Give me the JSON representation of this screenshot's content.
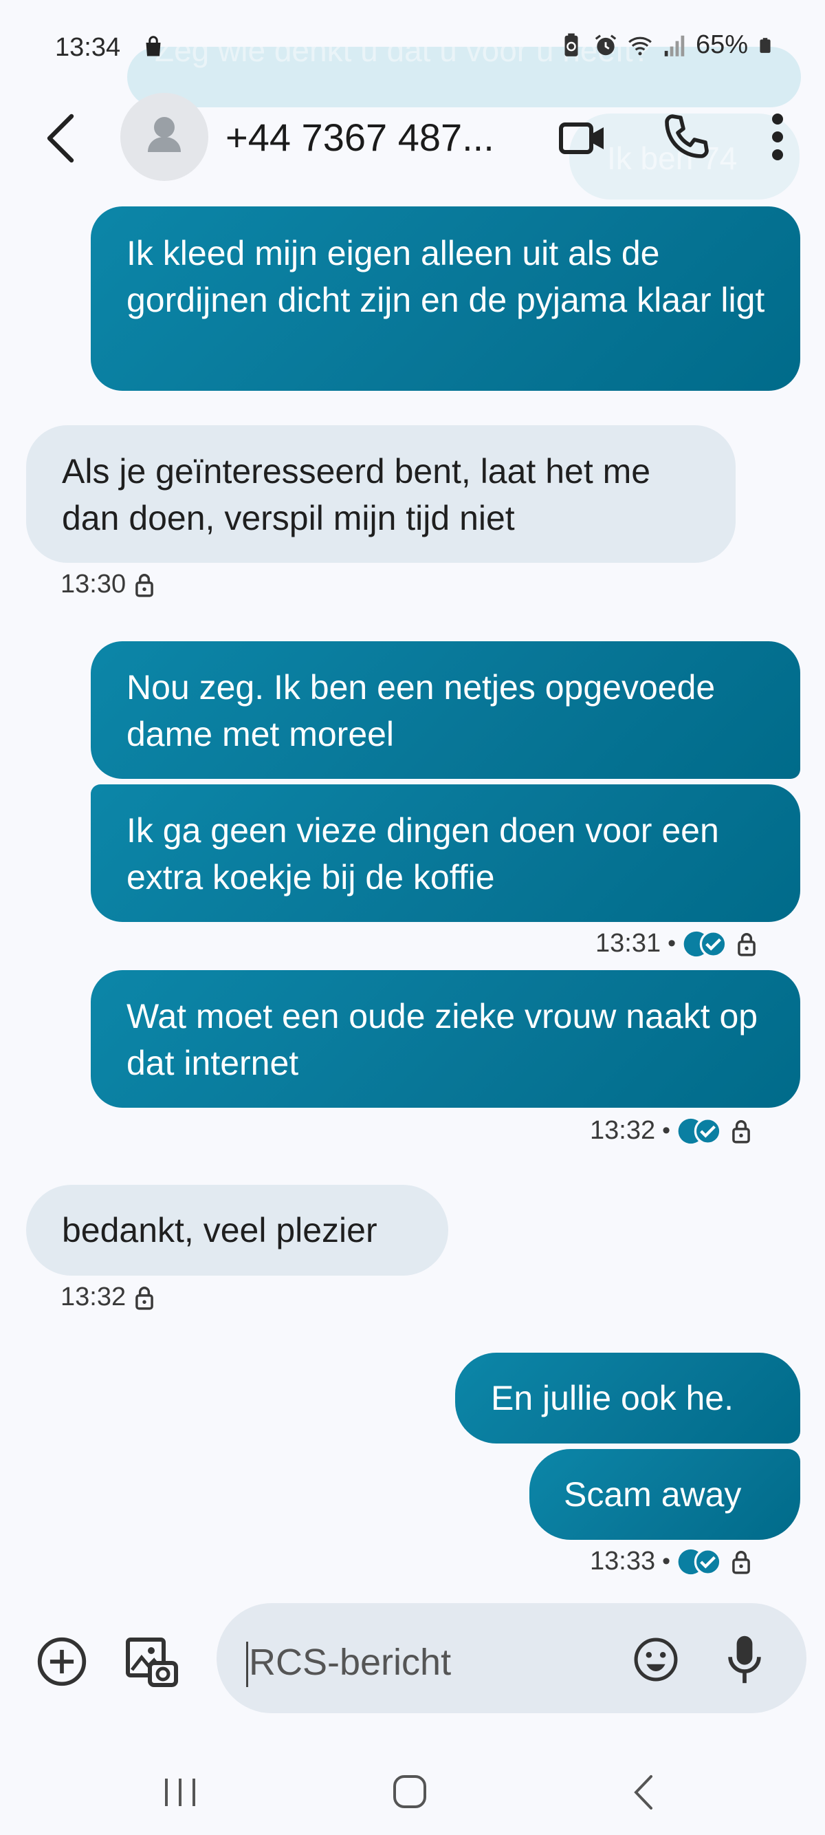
{
  "status_bar": {
    "time": "13:34",
    "battery": "65%",
    "icons": [
      "shopping-bag-icon",
      "battery-saver-icon",
      "alarm-icon",
      "wifi-icon",
      "signal-icon",
      "battery-icon"
    ]
  },
  "ghost_messages": {
    "line1": "Zeg wie denkt u dat u voor u heeft?",
    "line2": "Ik ben 74"
  },
  "header": {
    "contact": "+44 7367 487...",
    "icons": [
      "back-arrow-icon",
      "avatar-icon",
      "video-call-icon",
      "phone-icon",
      "more-vert-icon"
    ]
  },
  "messages": [
    {
      "dir": "out",
      "text": "Ik kleed mijn eigen alleen uit als de gordijnen dicht zijn en de pyjama klaar ligt"
    },
    {
      "dir": "in",
      "text": "Als je geïnteresseerd bent, laat het me dan doen, verspil mijn tijd niet",
      "time": "13:30"
    },
    {
      "dir": "out",
      "text": "Nou zeg. Ik ben een netjes opgevoede dame met moreel"
    },
    {
      "dir": "out",
      "text": "Ik ga geen vieze dingen doen voor een extra koekje bij de koffie",
      "time": "13:31"
    },
    {
      "dir": "out",
      "text": "Wat moet een oude zieke vrouw naakt op dat internet",
      "time": "13:32"
    },
    {
      "dir": "in",
      "text": "bedankt, veel plezier",
      "time": "13:32"
    },
    {
      "dir": "out",
      "text": "En jullie ook he."
    },
    {
      "dir": "out",
      "text": "Scam away",
      "time": "13:33"
    }
  ],
  "meta": {
    "separator": "•"
  },
  "composer": {
    "placeholder": "RCS-bericht",
    "icons": [
      "add-circle-icon",
      "gallery-icon",
      "emoji-icon",
      "microphone-icon"
    ]
  },
  "colors": {
    "outgoing": "#087697",
    "incoming": "#e2eaf1",
    "background": "#f8f9fd"
  },
  "navbar": {
    "icons": [
      "recent-apps-icon",
      "home-icon",
      "back-icon"
    ]
  }
}
